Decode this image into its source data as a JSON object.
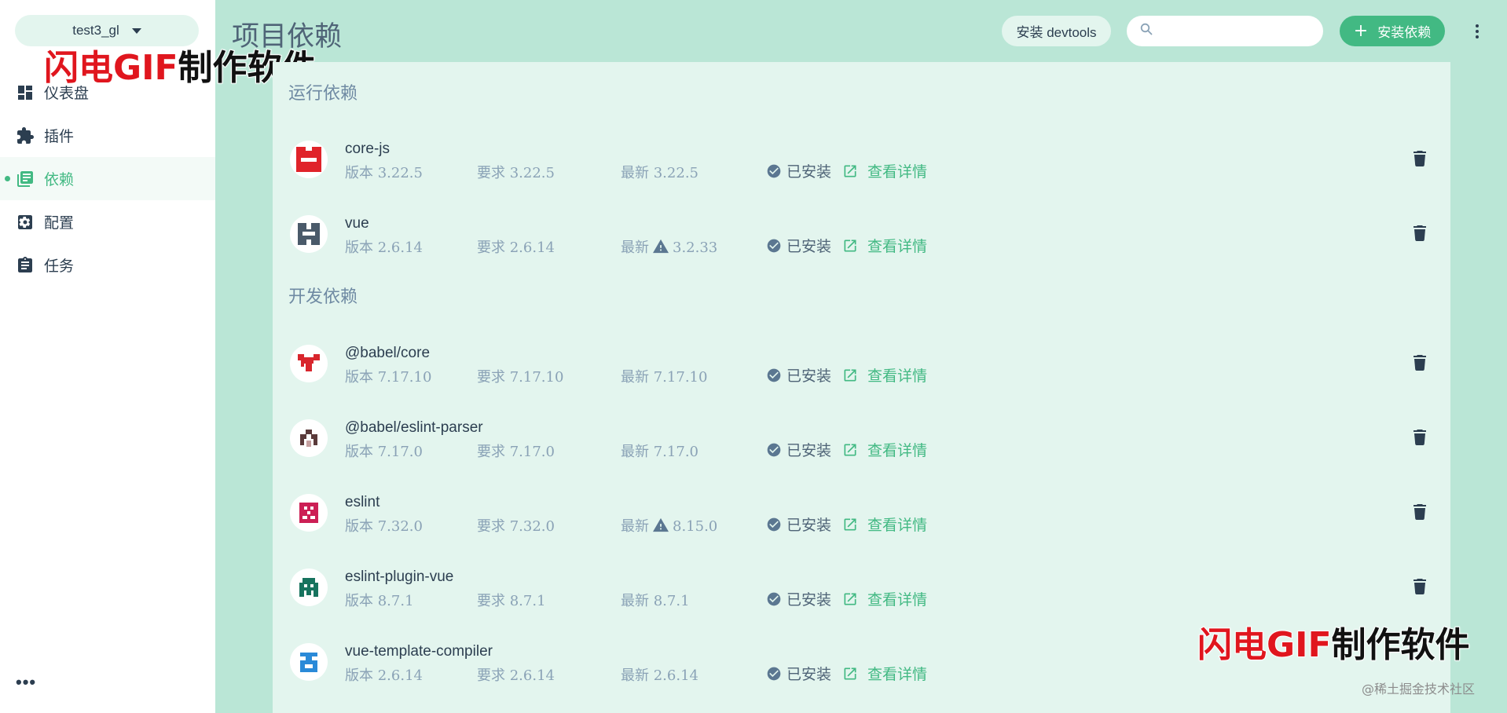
{
  "sidebar": {
    "project": "test3_gl",
    "items": [
      {
        "label": "仪表盘",
        "icon": "dashboard-icon",
        "active": false
      },
      {
        "label": "插件",
        "icon": "puzzle-icon",
        "active": false
      },
      {
        "label": "依赖",
        "icon": "library-books-icon",
        "active": true
      },
      {
        "label": "配置",
        "icon": "settings-icon",
        "active": false
      },
      {
        "label": "任务",
        "icon": "clipboard-icon",
        "active": false
      }
    ],
    "more": "•••"
  },
  "header": {
    "title": "项目依赖",
    "devtools_label": "安装 devtools",
    "search_placeholder": "",
    "install_label": "安装依赖",
    "install_icon": "+"
  },
  "watermark": {
    "red": "闪电GIF",
    "black": "制作软件"
  },
  "credit": "@稀土掘金技术社区",
  "sections": {
    "runtime": "运行依赖",
    "dev": "开发依赖"
  },
  "labels": {
    "installed": "已安装",
    "details": "查看详情"
  },
  "colors": {
    "accent": "#42b983",
    "background": "#bae6d6",
    "panel": "#e3f5ee"
  },
  "runtime_deps": [
    {
      "name": "core-js",
      "version": "版本 3.22.5",
      "required": "要求 3.22.5",
      "latest_label": "最新",
      "latest": "3.22.5",
      "warning": false
    },
    {
      "name": "vue",
      "version": "版本 2.6.14",
      "required": "要求 2.6.14",
      "latest_label": "最新",
      "latest": "3.2.33",
      "warning": true
    }
  ],
  "dev_deps": [
    {
      "name": "@babel/core",
      "version": "版本 7.17.10",
      "required": "要求 7.17.10",
      "latest_label": "最新",
      "latest": "7.17.10",
      "warning": false
    },
    {
      "name": "@babel/eslint-parser",
      "version": "版本 7.17.0",
      "required": "要求 7.17.0",
      "latest_label": "最新",
      "latest": "7.17.0",
      "warning": false
    },
    {
      "name": "eslint",
      "version": "版本 7.32.0",
      "required": "要求 7.32.0",
      "latest_label": "最新",
      "latest": "8.15.0",
      "warning": true
    },
    {
      "name": "eslint-plugin-vue",
      "version": "版本 8.7.1",
      "required": "要求 8.7.1",
      "latest_label": "最新",
      "latest": "8.7.1",
      "warning": false
    },
    {
      "name": "vue-template-compiler",
      "version": "版本 2.6.14",
      "required": "要求 2.6.14",
      "latest_label": "最新",
      "latest": "2.6.14",
      "warning": false
    }
  ]
}
